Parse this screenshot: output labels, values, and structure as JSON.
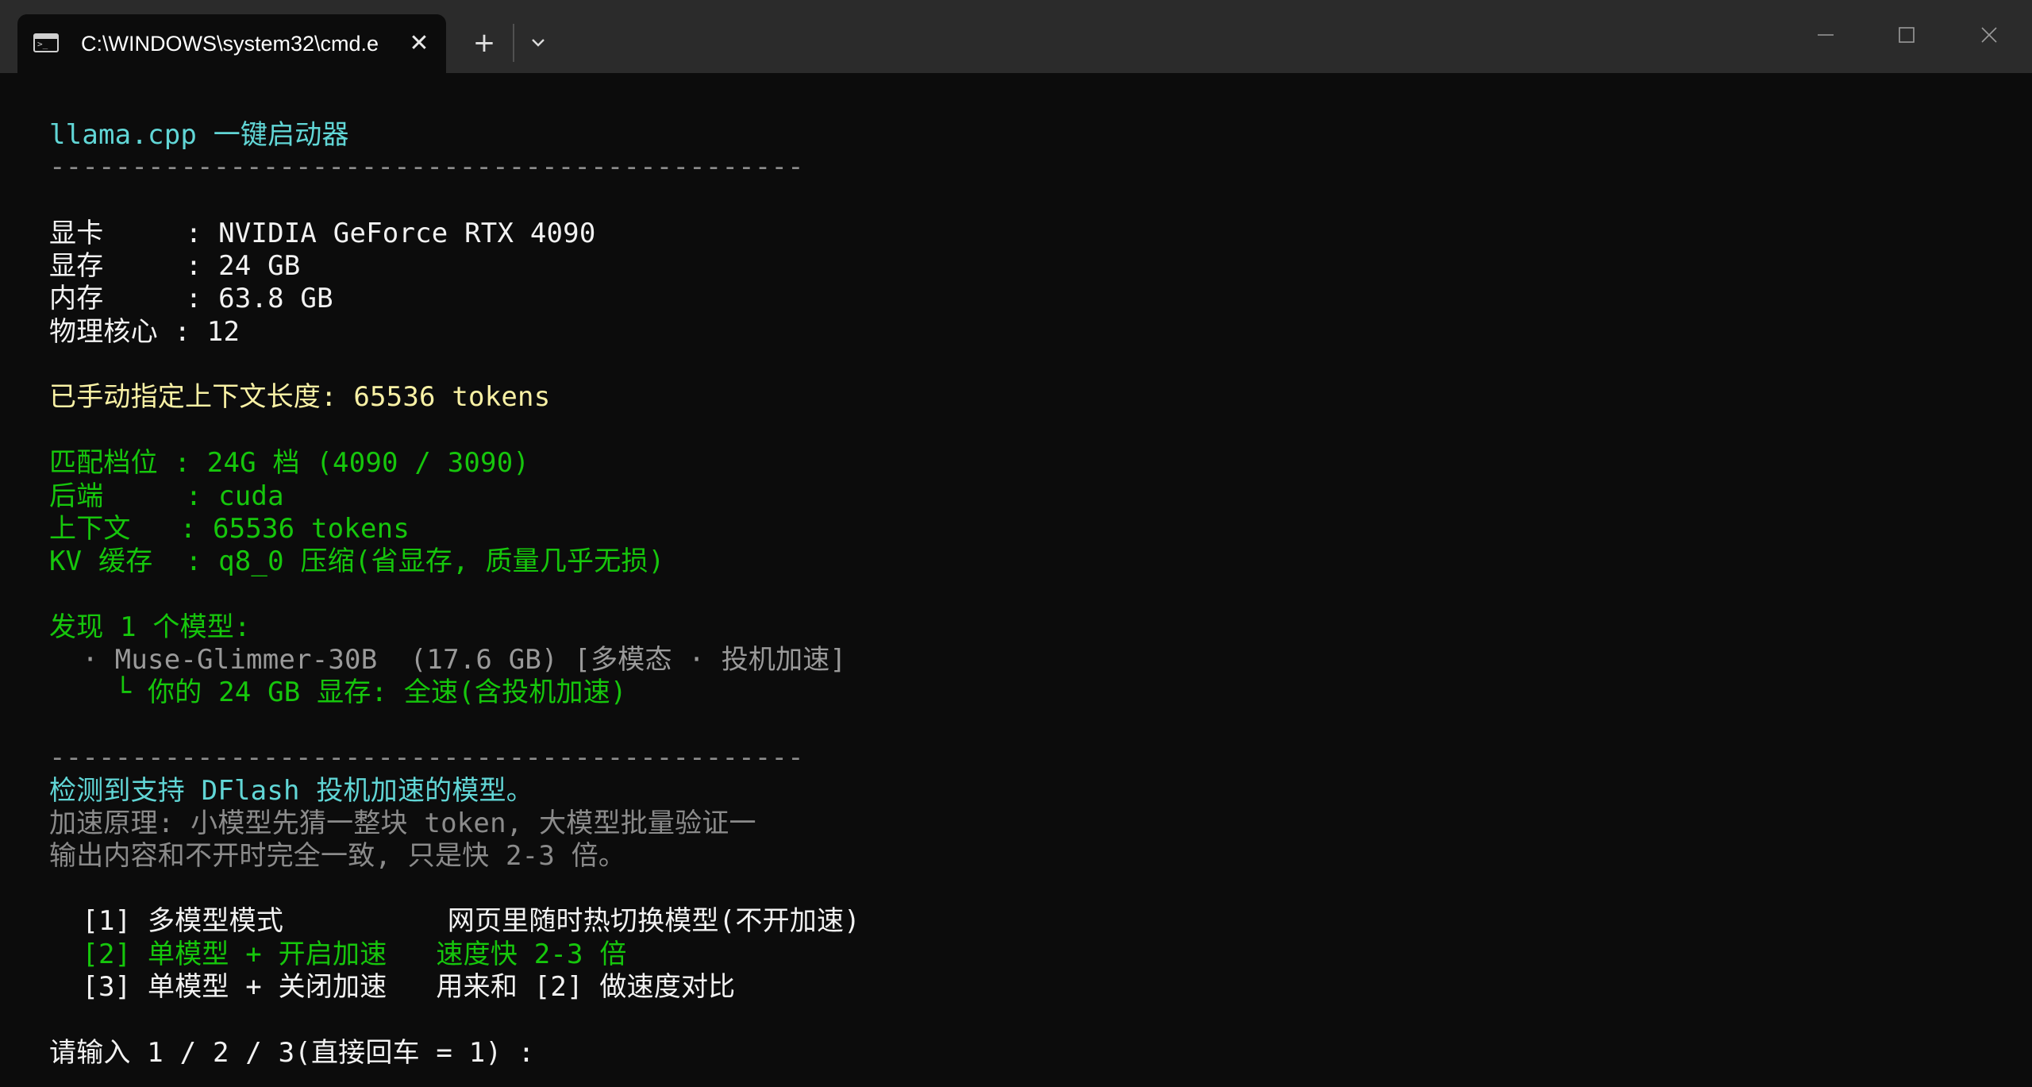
{
  "window": {
    "tab_title": "C:\\WINDOWS\\system32\\cmd.e",
    "tab_icon": "terminal-icon",
    "close_tab_symbol": "✕",
    "new_tab_symbol": "+",
    "minimize_symbol": "—",
    "maximize_symbol": "☐",
    "close_symbol": "✕"
  },
  "terminal": {
    "title": "llama.cpp 一键启动器",
    "divider": "----------------------------------------------",
    "gpu_label": "显卡     : NVIDIA GeForce RTX 4090",
    "vram_label": "显存     : 24 GB",
    "ram_label": "内存     : 63.8 GB",
    "cores_label": "物理核心 : 12",
    "context_set": "已手动指定上下文长度: 65536 tokens",
    "match_tier": "匹配档位 : 24G 档 (4090 / 3090)",
    "backend": "后端     : cuda",
    "context": "上下文   : 65536 tokens",
    "kv_cache": "KV 缓存  : q8_0 压缩(省显存, 质量几乎无损)",
    "models_found": "发现 1 个模型:",
    "model_entry": "  · Muse-Glimmer-30B  (17.6 GB) [多模态 · 投机加速]",
    "model_status": "    └ 你的 24 GB 显存: 全速(含投机加速)",
    "divider2": "----------------------------------------------",
    "dflash_detected": "检测到支持 DFlash 投机加速的模型。",
    "principle_1": "加速原理: 小模型先猜一整块 token, 大模型批量验证一",
    "principle_2": "输出内容和不开时完全一致, 只是快 2-3 倍。",
    "option_1": "  [1] 多模型模式          网页里随时热切换模型(不开加速)",
    "option_2": "  [2] 单模型 + 开启加速   速度快 2-3 倍",
    "option_3": "  [3] 单模型 + 关闭加速   用来和 [2] 做速度对比",
    "prompt": "请输入 1 / 2 / 3(直接回车 = 1) : "
  },
  "colors": {
    "background": "#0c0c0c",
    "titlebar": "#2b2b2b",
    "cyan": "#61d6d6",
    "green": "#16c60c",
    "yellow": "#f9f1a5",
    "white": "#f2f2f2",
    "gray": "#8b8b8b"
  }
}
